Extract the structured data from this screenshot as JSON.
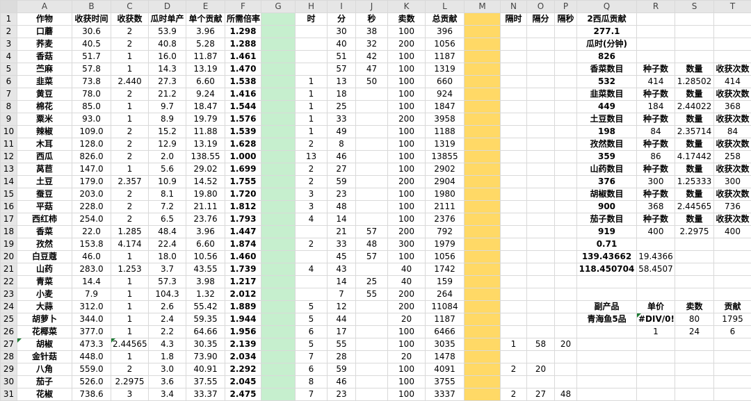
{
  "columns": [
    "A",
    "B",
    "C",
    "D",
    "E",
    "F",
    "G",
    "H",
    "I",
    "J",
    "K",
    "L",
    "M",
    "N",
    "O",
    "P",
    "Q",
    "R",
    "S",
    "T"
  ],
  "colors": {
    "green_column": "#c6efce",
    "yellow_column": "#ffd966",
    "highlight_text": "#e00000",
    "header_bg": "#e6e6e6"
  },
  "rows": [
    [
      "作物",
      "收获时间",
      "收获数",
      "瓜时单产",
      "单个贡献",
      "所需倍率",
      "",
      "时",
      "分",
      "秒",
      "卖数",
      "总贡献",
      "",
      "隔时",
      "隔分",
      "隔秒",
      "2西瓜贡献",
      "",
      "",
      ""
    ],
    [
      "口蘑",
      "30.6",
      "2",
      "53.9",
      "3.96",
      "1.298",
      "",
      "",
      "30",
      "38",
      "100",
      "396",
      "",
      "",
      "",
      "",
      "277.1",
      "",
      "",
      ""
    ],
    [
      "荞麦",
      "40.5",
      "2",
      "40.8",
      "5.28",
      "1.288",
      "",
      "",
      "40",
      "32",
      "200",
      "1056",
      "",
      "",
      "",
      "",
      "瓜时(分钟)",
      "",
      "",
      ""
    ],
    [
      "香菇",
      "51.7",
      "1",
      "16.0",
      "11.87",
      "1.461",
      "",
      "",
      "51",
      "42",
      "100",
      "1187",
      "",
      "",
      "",
      "",
      "826",
      "",
      "",
      ""
    ],
    [
      "苎麻",
      "57.8",
      "1",
      "14.3",
      "13.19",
      "1.470",
      "",
      "",
      "57",
      "47",
      "100",
      "1319",
      "",
      "",
      "",
      "",
      "香菜数目",
      "种子数",
      "数量",
      "收获次数"
    ],
    [
      "韭菜",
      "73.8",
      "2.440",
      "27.3",
      "6.60",
      "1.538",
      "",
      "1",
      "13",
      "50",
      "100",
      "660",
      "",
      "",
      "",
      "",
      "532",
      "414",
      "1.28502",
      "414"
    ],
    [
      "黄豆",
      "78.0",
      "2",
      "21.2",
      "9.24",
      "1.416",
      "",
      "1",
      "18",
      "",
      "100",
      "924",
      "",
      "",
      "",
      "",
      "韭菜数目",
      "种子数",
      "数量",
      "收获次数"
    ],
    [
      "棉花",
      "85.0",
      "1",
      "9.7",
      "18.47",
      "1.544",
      "",
      "1",
      "25",
      "",
      "100",
      "1847",
      "",
      "",
      "",
      "",
      "449",
      "184",
      "2.44022",
      "368"
    ],
    [
      "粟米",
      "93.0",
      "1",
      "8.9",
      "19.79",
      "1.576",
      "",
      "1",
      "33",
      "",
      "200",
      "3958",
      "",
      "",
      "",
      "",
      "土豆数目",
      "种子数",
      "数量",
      "收获次数"
    ],
    [
      "辣椒",
      "109.0",
      "2",
      "15.2",
      "11.88",
      "1.539",
      "",
      "1",
      "49",
      "",
      "100",
      "1188",
      "",
      "",
      "",
      "",
      "198",
      "84",
      "2.35714",
      "84"
    ],
    [
      "木耳",
      "128.0",
      "2",
      "12.9",
      "13.19",
      "1.628",
      "",
      "2",
      "8",
      "",
      "100",
      "1319",
      "",
      "",
      "",
      "",
      "孜然数目",
      "种子数",
      "数量",
      "收获次数"
    ],
    [
      "西瓜",
      "826.0",
      "2",
      "2.0",
      "138.55",
      "1.000",
      "",
      "13",
      "46",
      "",
      "100",
      "13855",
      "",
      "",
      "",
      "",
      "359",
      "86",
      "4.17442",
      "258"
    ],
    [
      "莴苣",
      "147.0",
      "1",
      "5.6",
      "29.02",
      "1.699",
      "",
      "2",
      "27",
      "",
      "100",
      "2902",
      "",
      "",
      "",
      "",
      "山药数目",
      "种子数",
      "数量",
      "收获次数"
    ],
    [
      "土豆",
      "179.0",
      "2.357",
      "10.9",
      "14.52",
      "1.755",
      "",
      "2",
      "59",
      "",
      "200",
      "2904",
      "",
      "",
      "",
      "",
      "376",
      "300",
      "1.25333",
      "300"
    ],
    [
      "蚕豆",
      "203.0",
      "2",
      "8.1",
      "19.80",
      "1.720",
      "",
      "3",
      "23",
      "",
      "100",
      "1980",
      "",
      "",
      "",
      "",
      "胡椒数目",
      "种子数",
      "数量",
      "收获次数"
    ],
    [
      "平菇",
      "228.0",
      "2",
      "7.2",
      "21.11",
      "1.812",
      "",
      "3",
      "48",
      "",
      "100",
      "2111",
      "",
      "",
      "",
      "",
      "900",
      "368",
      "2.44565",
      "736"
    ],
    [
      "西红柿",
      "254.0",
      "2",
      "6.5",
      "23.76",
      "1.793",
      "",
      "4",
      "14",
      "",
      "100",
      "2376",
      "",
      "",
      "",
      "",
      "茄子数目",
      "种子数",
      "数量",
      "收获次数"
    ],
    [
      "香菜",
      "22.0",
      "1.285",
      "48.4",
      "3.96",
      "1.447",
      "",
      "",
      "21",
      "57",
      "200",
      "792",
      "",
      "",
      "",
      "",
      "919",
      "400",
      "2.2975",
      "400"
    ],
    [
      "孜然",
      "153.8",
      "4.174",
      "22.4",
      "6.60",
      "1.874",
      "",
      "2",
      "33",
      "48",
      "300",
      "1979",
      "",
      "",
      "",
      "",
      "0.71",
      "",
      "",
      ""
    ],
    [
      "白豆蔻",
      "46.0",
      "1",
      "18.0",
      "10.56",
      "1.460",
      "",
      "",
      "45",
      "57",
      "100",
      "1056",
      "",
      "",
      "",
      "",
      "139.43662",
      "19.4366",
      "",
      ""
    ],
    [
      "山药",
      "283.0",
      "1.253",
      "3.7",
      "43.55",
      "1.739",
      "",
      "4",
      "43",
      "",
      "40",
      "1742",
      "",
      "",
      "",
      "",
      "118.450704",
      "58.4507",
      "",
      ""
    ],
    [
      "青菜",
      "14.4",
      "1",
      "57.3",
      "3.98",
      "1.217",
      "",
      "",
      "14",
      "25",
      "40",
      "159",
      "",
      "",
      "",
      "",
      "",
      "",
      "",
      ""
    ],
    [
      "小麦",
      "7.9",
      "1",
      "104.3",
      "1.32",
      "2.012",
      "",
      "",
      "7",
      "55",
      "200",
      "264",
      "",
      "",
      "",
      "",
      "",
      "",
      "",
      ""
    ],
    [
      "大蒜",
      "312.0",
      "1",
      "2.6",
      "55.42",
      "1.889",
      "",
      "5",
      "12",
      "",
      "200",
      "11084",
      "",
      "",
      "",
      "",
      "副产品",
      "单价",
      "卖数",
      "贡献"
    ],
    [
      "胡萝卜",
      "344.0",
      "1",
      "2.4",
      "59.35",
      "1.944",
      "",
      "5",
      "44",
      "",
      "20",
      "1187",
      "",
      "",
      "",
      "",
      "青海鱼5品",
      "#DIV/0!",
      "80",
      "1795"
    ],
    [
      "花椰菜",
      "377.0",
      "1",
      "2.2",
      "64.66",
      "1.956",
      "",
      "6",
      "17",
      "",
      "100",
      "6466",
      "",
      "",
      "",
      "",
      "",
      "1",
      "24",
      "6"
    ],
    [
      "胡椒",
      "473.3",
      "2.44565",
      "4.3",
      "30.35",
      "2.139",
      "",
      "5",
      "55",
      "",
      "100",
      "3035",
      "",
      "1",
      "58",
      "20",
      "",
      "",
      "",
      ""
    ],
    [
      "金针菇",
      "448.0",
      "1",
      "1.8",
      "73.90",
      "2.034",
      "",
      "7",
      "28",
      "",
      "20",
      "1478",
      "",
      "",
      "",
      "",
      "",
      "",
      "",
      ""
    ],
    [
      "八角",
      "559.0",
      "2",
      "3.0",
      "40.91",
      "2.292",
      "",
      "6",
      "59",
      "",
      "100",
      "4091",
      "",
      "2",
      "20",
      "",
      "",
      "",
      "",
      ""
    ],
    [
      "茄子",
      "526.0",
      "2.2975",
      "3.6",
      "37.55",
      "2.045",
      "",
      "8",
      "46",
      "",
      "100",
      "3755",
      "",
      "",
      "",
      "",
      "",
      "",
      "",
      ""
    ],
    [
      "花椒",
      "738.6",
      "3",
      "3.4",
      "33.37",
      "2.475",
      "",
      "7",
      "23",
      "",
      "100",
      "3337",
      "",
      "2",
      "27",
      "48",
      "",
      "",
      "",
      ""
    ]
  ]
}
